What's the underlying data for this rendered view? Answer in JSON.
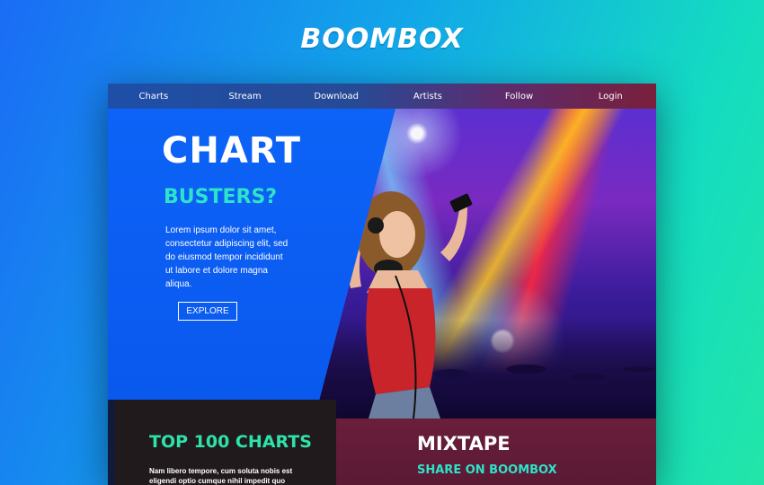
{
  "brand": {
    "title": "BOOMBOX"
  },
  "nav": {
    "items": [
      {
        "label": "Charts"
      },
      {
        "label": "Stream"
      },
      {
        "label": "Download"
      },
      {
        "label": "Artists"
      },
      {
        "label": "Follow"
      },
      {
        "label": "Login"
      }
    ]
  },
  "hero": {
    "title": "CHART",
    "subtitle": "BUSTERS?",
    "body": "Lorem ipsum dolor sit amet, consectetur adipiscing elit, sed do eiusmod tempor incididunt ut labore et dolore magna aliqua.",
    "button_label": "EXPLORE"
  },
  "top_charts": {
    "title": "TOP 100 CHARTS",
    "body": "Nam libero tempore, cum soluta nobis est eligendi optio cumque nihil impedit quo"
  },
  "mixtape": {
    "title": "MIXTAPE",
    "subtitle": "SHARE ON BOOMBOX"
  },
  "colors": {
    "accent_teal": "#2de3c9",
    "hero_blue": "#0b5ff5",
    "dark_panel": "#211a1c",
    "mixtape_panel": "#6a1e3a"
  }
}
